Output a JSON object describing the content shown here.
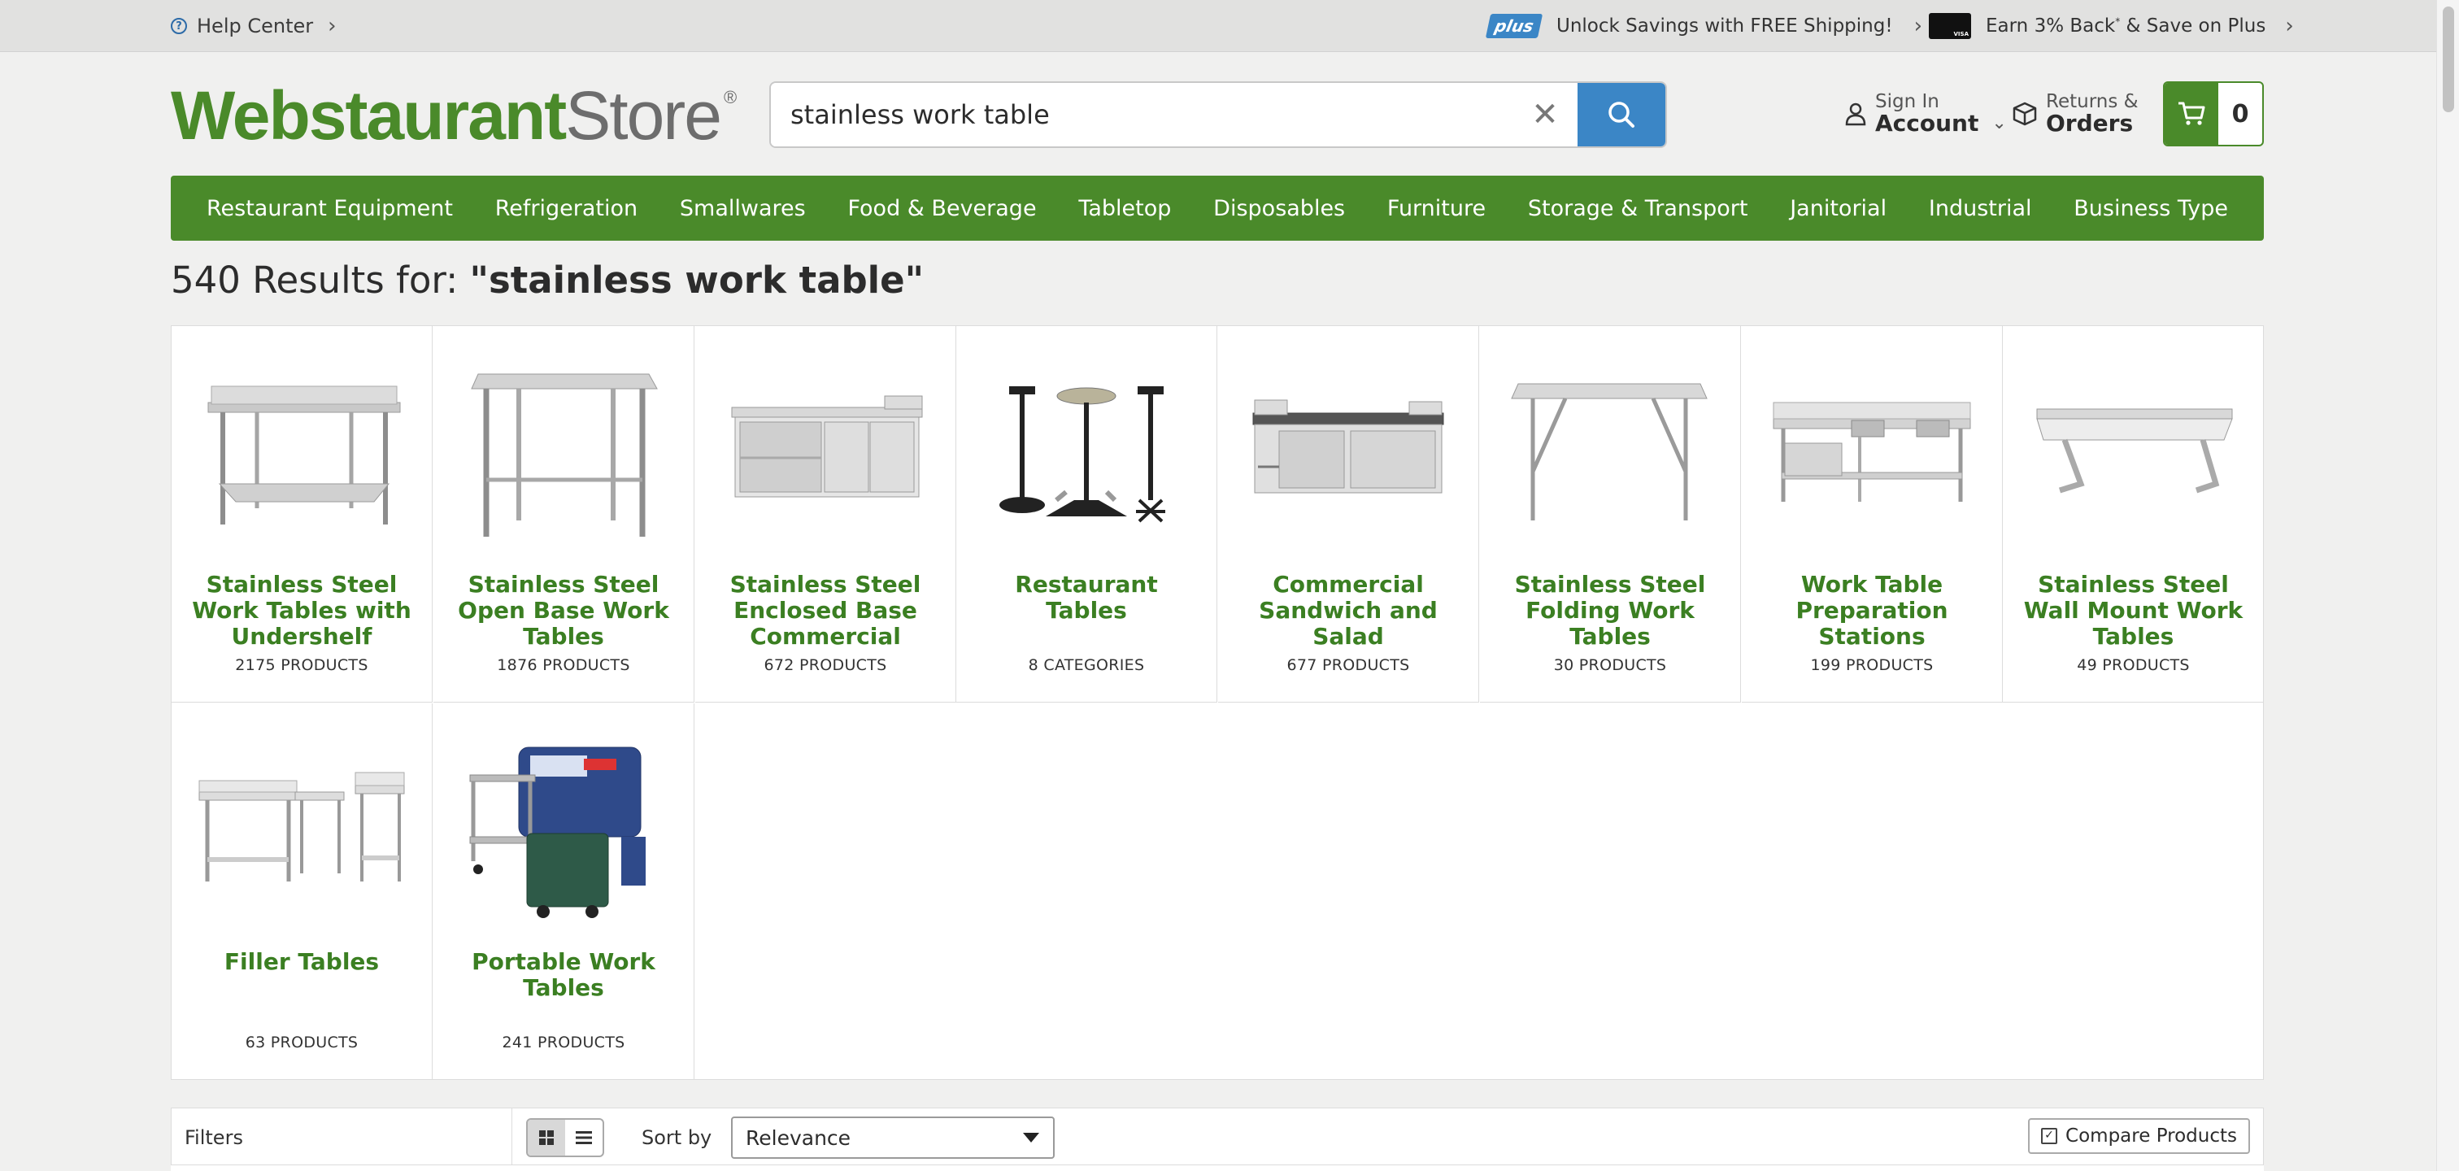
{
  "utility": {
    "help_label": "Help Center",
    "plus_badge": "plus",
    "promo_shipping": "Unlock Savings with FREE Shipping!",
    "promo_card": "Earn 3% Back",
    "promo_card_mark": "*",
    "promo_card_tail": " & Save on Plus"
  },
  "logo": {
    "part1": "Webstaurant",
    "part2": "Store",
    "reg": "®"
  },
  "search": {
    "value": "stainless work table",
    "placeholder": ""
  },
  "account": {
    "sign_in": "Sign In",
    "account": "Account"
  },
  "returns": {
    "line1": "Returns &",
    "line2": "Orders"
  },
  "cart": {
    "count": "0"
  },
  "nav": {
    "items": [
      "Restaurant Equipment",
      "Refrigeration",
      "Smallwares",
      "Food & Beverage",
      "Tabletop",
      "Disposables",
      "Furniture",
      "Storage & Transport",
      "Janitorial",
      "Industrial",
      "Business Type"
    ]
  },
  "results": {
    "count_text": "540 Results for: ",
    "query": "\"stainless work table\""
  },
  "categories": [
    {
      "name": "Stainless Steel Work Tables with Undershelf",
      "count": "2175 PRODUCTS",
      "icon": "table-undershelf"
    },
    {
      "name": "Stainless Steel Open Base Work Tables",
      "count": "1876 PRODUCTS",
      "icon": "table-open-base"
    },
    {
      "name": "Stainless Steel Enclosed Base Commercial Work",
      "count": "672 PRODUCTS",
      "icon": "table-enclosed"
    },
    {
      "name": "Restaurant Tables",
      "count": "8 CATEGORIES",
      "icon": "restaurant-table"
    },
    {
      "name": "Commercial Sandwich and Salad Preparation",
      "count": "677 PRODUCTS",
      "icon": "prep-cooler"
    },
    {
      "name": "Stainless Steel Folding Work Tables",
      "count": "30 PRODUCTS",
      "icon": "folding-table"
    },
    {
      "name": "Work Table Preparation Stations",
      "count": "199 PRODUCTS",
      "icon": "prep-station"
    },
    {
      "name": "Stainless Steel Wall Mount Work Tables",
      "count": "49 PRODUCTS",
      "icon": "wall-mount-table"
    },
    {
      "name": "Filler Tables",
      "count": "63 PRODUCTS",
      "icon": "filler-tables"
    },
    {
      "name": "Portable Work Tables",
      "count": "241 PRODUCTS",
      "icon": "portable-cart"
    }
  ],
  "toolbar": {
    "filters_label": "Filters",
    "sort_label": "Sort by",
    "sort_value": "Relevance",
    "compare_label": "Compare Products"
  },
  "colors": {
    "brand_green": "#4a8a2a",
    "link_green": "#3b7f22",
    "accent_blue": "#3b86c6",
    "page_bg": "#f0f0ef"
  }
}
